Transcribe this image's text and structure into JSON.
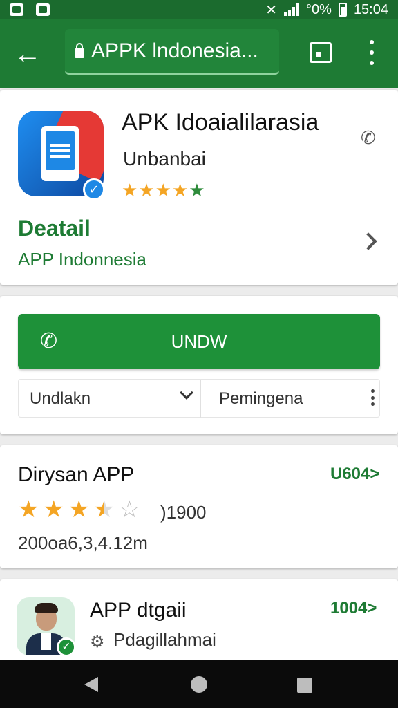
{
  "status_bar": {
    "percent": "°0%",
    "time": "15:04"
  },
  "browser": {
    "url_text": "APPK lndonesia..."
  },
  "app_card": {
    "title": "APK Idoaialilarasia",
    "subtitle": "Unbanbai",
    "rating_stars": 5,
    "detail_title": "Deatail",
    "detail_subtitle": "APP Indonnesia"
  },
  "download_card": {
    "button_label": "UNDW",
    "option_left": "Undlakn",
    "option_right": "Pemingena"
  },
  "review_card": {
    "title": "Dirysan APP",
    "link": "U604>",
    "rating": 3.5,
    "count": ")1900",
    "meta": "200oa6,3,4.12m"
  },
  "profile_card": {
    "title": "APP dtgaii",
    "link": "1004>",
    "subtitle": "Pdagillahmai"
  },
  "colors": {
    "primary": "#1e7b34",
    "button": "#1e9139",
    "star": "#f4a524",
    "accent_star": "#2e8b3b"
  }
}
